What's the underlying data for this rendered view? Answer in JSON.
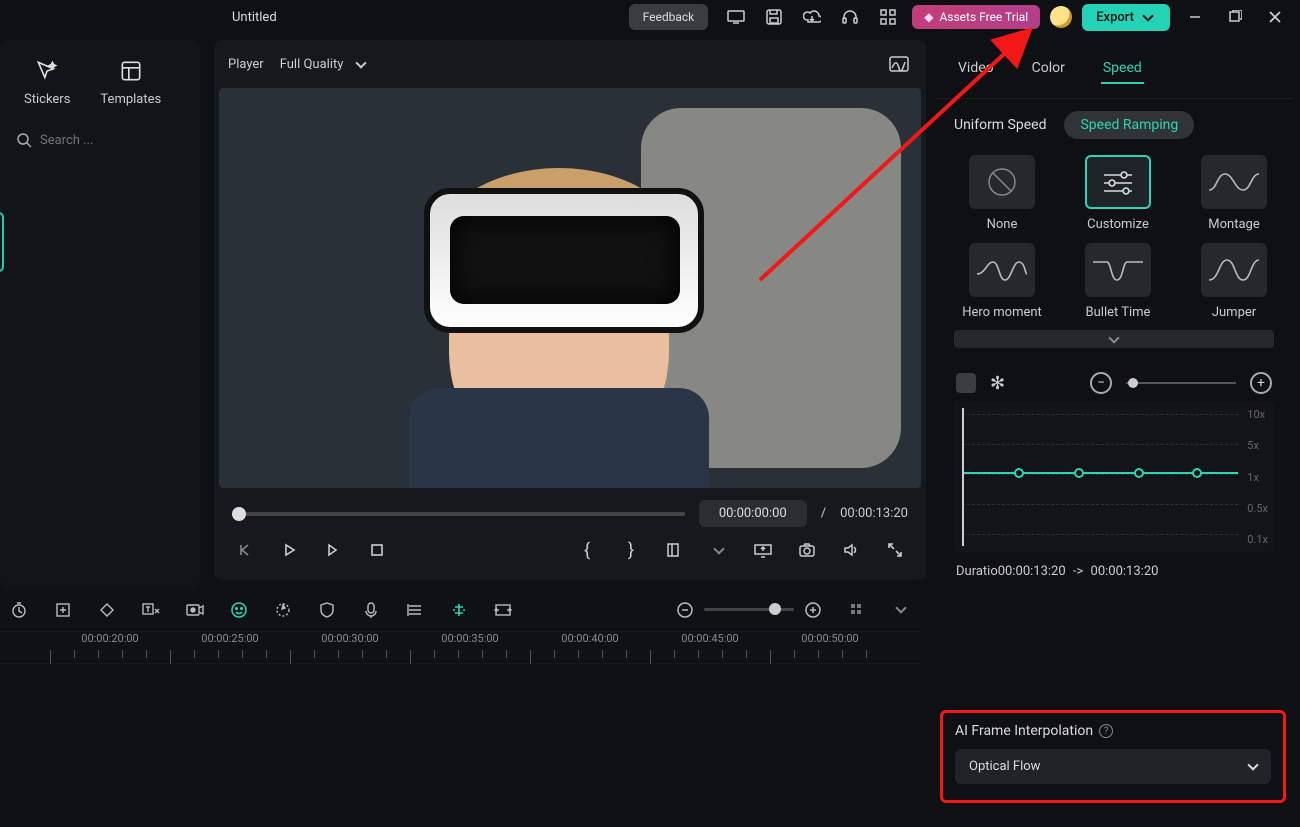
{
  "titlebar": {
    "project_title": "Untitled",
    "feedback": "Feedback",
    "assets_trial": "Assets Free Trial",
    "export": "Export"
  },
  "sidebar": {
    "tabs": {
      "stickers": "Stickers",
      "templates": "Templates"
    },
    "search_placeholder": "Search ..."
  },
  "player": {
    "label": "Player",
    "quality": "Full Quality",
    "time_current": "00:00:00:00",
    "time_separator": "/",
    "time_total": "00:00:13:20"
  },
  "inspector": {
    "tabs": {
      "video": "Video",
      "color": "Color",
      "speed": "Speed"
    },
    "active_tab": "speed",
    "speed_mode": {
      "uniform": "Uniform Speed",
      "ramping": "Speed Ramping"
    },
    "presets": [
      {
        "id": "none",
        "label": "None"
      },
      {
        "id": "customize",
        "label": "Customize"
      },
      {
        "id": "montage",
        "label": "Montage"
      },
      {
        "id": "hero",
        "label": "Hero moment"
      },
      {
        "id": "bullet",
        "label": "Bullet Time"
      },
      {
        "id": "jumper",
        "label": "Jumper"
      }
    ],
    "active_preset": "customize",
    "graph_ticks": [
      "10x",
      "5x",
      "1x",
      "0.5x",
      "0.1x"
    ],
    "duration_label": "Duratio",
    "duration_from": "00:00:13:20",
    "duration_sep": "->",
    "duration_to": "00:00:13:20"
  },
  "ai": {
    "title": "AI Frame Interpolation",
    "selected": "Optical Flow"
  },
  "timeline": {
    "marks": [
      "00:00:20:00",
      "00:00:25:00",
      "00:00:30:00",
      "00:00:35:00",
      "00:00:40:00",
      "00:00:45:00",
      "00:00:50:00"
    ]
  }
}
